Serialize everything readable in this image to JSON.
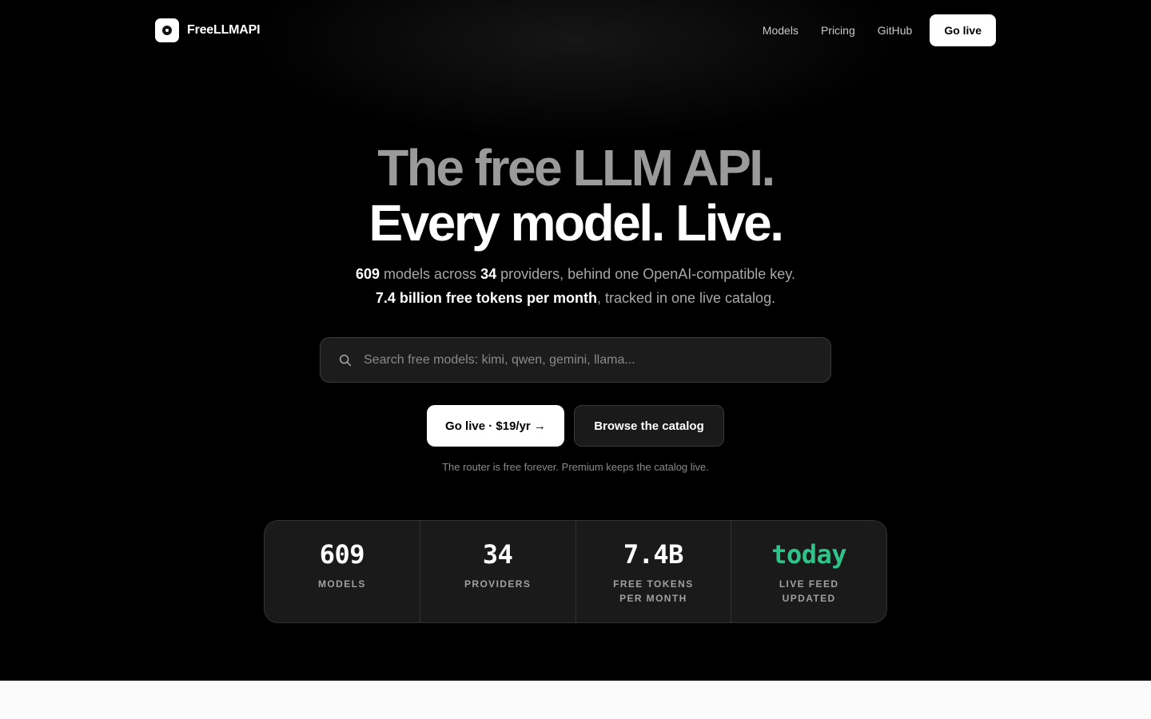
{
  "nav": {
    "brand": "FreeLLMAPI",
    "links": [
      "Models",
      "Pricing",
      "GitHub"
    ],
    "cta": "Go live"
  },
  "hero": {
    "title_line1": "The free LLM API.",
    "title_line2": "Every model. Live.",
    "sub1": {
      "models_count": "609",
      "models_text": " models across ",
      "providers_count": "34",
      "providers_text": " providers, behind one OpenAI-compatible key."
    },
    "sub2": {
      "tokens_strong": "7.4 billion free tokens per month",
      "tokens_text": ", tracked in one live catalog."
    }
  },
  "search": {
    "placeholder": "Search free models: kimi, qwen, gemini, llama..."
  },
  "buttons": {
    "primary": "Go live · $19/yr →",
    "secondary": "Browse the catalog"
  },
  "note": "The router is free forever. Premium keeps the catalog live.",
  "stats": [
    {
      "value": "609",
      "label": "MODELS"
    },
    {
      "value": "34",
      "label": "PROVIDERS"
    },
    {
      "value": "7.4B",
      "label": "FREE TOKENS PER MONTH"
    },
    {
      "value": "today",
      "label": "LIVE FEED UPDATED"
    }
  ],
  "colors": {
    "accent_green": "#2fc38a",
    "background": "#000000"
  }
}
